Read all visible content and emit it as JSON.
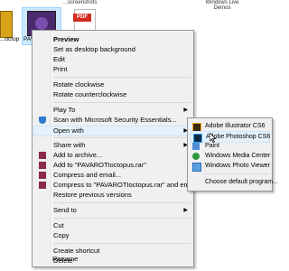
{
  "top_labels": {
    "left": "...screenshots",
    "right": "Windows Live Demos"
  },
  "desktop_icons": {
    "left_label": "...octop",
    "selected_label": "PAVAR...",
    "pdf_badge": "PDF"
  },
  "context_menu": {
    "items": [
      "Preview",
      "Set as desktop background",
      "Edit",
      "Print",
      "Rotate clockwise",
      "Rotate counterclockwise",
      "Play To",
      "Scan with Microsoft Security Essentials...",
      "Open with",
      "Share with",
      "Add to archive...",
      "Add to \"PAVAROTIoctopus.rar\"",
      "Compress and email...",
      "Compress to \"PAVAROTIoctopus.rar\" and email",
      "Restore previous versions",
      "Send to",
      "Cut",
      "Copy",
      "Create shortcut",
      "Delete",
      "Rename"
    ]
  },
  "open_with_submenu": {
    "items": [
      "Adobe Illustrator CS6",
      "Adobe Photoshop CS6",
      "Paint",
      "Windows Media Center",
      "Windows Photo Viewer",
      "Choose default program..."
    ]
  },
  "colors": {
    "highlight": "#e5f1fb",
    "menu_bg": "#f0f0f0",
    "selected_tile": "#cce8ff"
  }
}
